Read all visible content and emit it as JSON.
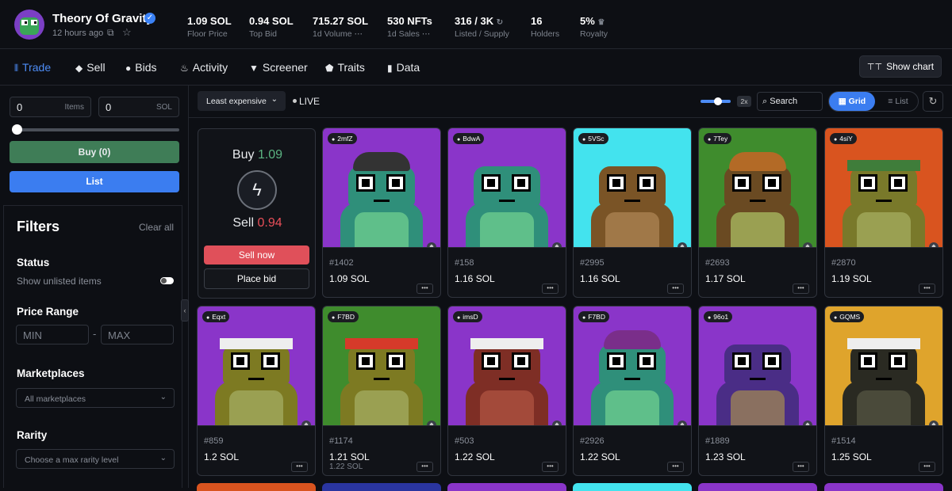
{
  "collection": {
    "title": "Theory Of Gravity",
    "updated": "12 hours ago",
    "stats": [
      {
        "value": "1.09 SOL",
        "label": "Floor Price"
      },
      {
        "value": "0.94 SOL",
        "label": "Top Bid"
      },
      {
        "value": "715.27 SOL",
        "label": "1d Volume",
        "icon": "more-icon"
      },
      {
        "value": "530 NFTs",
        "label": "1d Sales",
        "icon": "more-icon"
      },
      {
        "value": "316 / 3K",
        "label": "Listed / Supply",
        "icon": "refresh-icon"
      },
      {
        "value": "16",
        "label": "Holders"
      },
      {
        "value": "5%",
        "label": "Royalty",
        "icon": "crown-icon"
      }
    ]
  },
  "nav": {
    "tabs": [
      "Trade",
      "Sell",
      "Bids",
      "Activity",
      "Screener",
      "Traits",
      "Data"
    ],
    "active": "Trade",
    "show_chart": "Show chart"
  },
  "sidebar": {
    "items_value": "0",
    "items_suffix": "Items",
    "sol_value": "0",
    "sol_suffix": "SOL",
    "buy_label": "Buy (0)",
    "list_label": "List",
    "filters": {
      "title": "Filters",
      "clear_all": "Clear all",
      "status_title": "Status",
      "show_unlisted": "Show unlisted items",
      "price_range_title": "Price Range",
      "min_placeholder": "MIN",
      "max_placeholder": "MAX",
      "range_sep": "-",
      "marketplaces_title": "Marketplaces",
      "marketplaces_value": "All marketplaces",
      "rarity_title": "Rarity",
      "rarity_value": "Choose a max rarity level"
    }
  },
  "toolbar": {
    "sort": "Least expensive",
    "live": "LIVE",
    "zoom": "2x",
    "search_placeholder": "Search",
    "grid": "Grid",
    "list": "List"
  },
  "buysell": {
    "buy_label": "Buy",
    "buy_price": "1.09",
    "sell_label": "Sell",
    "sell_price": "0.94",
    "sell_now": "Sell now",
    "place_bid": "Place bid"
  },
  "nfts": [
    {
      "owner": "2mfZ",
      "id": "#1402",
      "price": "1.09 SOL",
      "bg": "#8a35c9",
      "skin": "#2f8f7a",
      "belly": "#5fbf8a",
      "accent": "#333333"
    },
    {
      "owner": "BdwA",
      "id": "#158",
      "price": "1.16 SOL",
      "bg": "#8a35c9",
      "skin": "#2f8f7a",
      "belly": "#5fbf8a",
      "accent": "#ff7b2b"
    },
    {
      "owner": "5VSc",
      "id": "#2995",
      "price": "1.16 SOL",
      "bg": "#43e3ee",
      "skin": "#7a5426",
      "belly": "#a07848",
      "accent": "#3a2a1a"
    },
    {
      "owner": "7Tey",
      "id": "#2693",
      "price": "1.17 SOL",
      "bg": "#3f8c2d",
      "skin": "#6a4a22",
      "belly": "#9aa052",
      "accent": "#b36a26"
    },
    {
      "owner": "4siY",
      "id": "#2870",
      "price": "1.19 SOL",
      "bg": "#d9541f",
      "skin": "#79792a",
      "belly": "#9aa052",
      "accent": "#3f7d3a"
    },
    {
      "owner": "Eqxt",
      "id": "#859",
      "price": "1.2 SOL",
      "bg": "#8a35c9",
      "skin": "#7d7a22",
      "belly": "#9aa052",
      "accent": "#eeeeee"
    },
    {
      "owner": "F7BD",
      "id": "#1174",
      "price": "1.21 SOL",
      "price2": "1.22 SOL",
      "bg": "#3f8c2d",
      "skin": "#7d7a22",
      "belly": "#9aa052",
      "accent": "#d63a2a"
    },
    {
      "owner": "imsD",
      "id": "#503",
      "price": "1.22 SOL",
      "bg": "#8a35c9",
      "skin": "#7e2e25",
      "belly": "#a34a3a",
      "accent": "#eeeeee"
    },
    {
      "owner": "F7BD",
      "id": "#2926",
      "price": "1.22 SOL",
      "bg": "#8a35c9",
      "skin": "#2f8f7a",
      "belly": "#5fbf8a",
      "accent": "#7a2e8a"
    },
    {
      "owner": "96o1",
      "id": "#1889",
      "price": "1.23 SOL",
      "bg": "#8a35c9",
      "skin": "#4a2d86",
      "belly": "#8a7060",
      "accent": "#3a2a1a"
    },
    {
      "owner": "GQMS",
      "id": "#1514",
      "price": "1.25 SOL",
      "bg": "#dfa42c",
      "skin": "#2a2a22",
      "belly": "#4a4a3a",
      "accent": "#eeeeee"
    }
  ],
  "peek_colors": [
    "#d9541f",
    "#2a35a0",
    "#8a35c9",
    "#43e3ee",
    "#8a35c9",
    "#8a35c9"
  ]
}
